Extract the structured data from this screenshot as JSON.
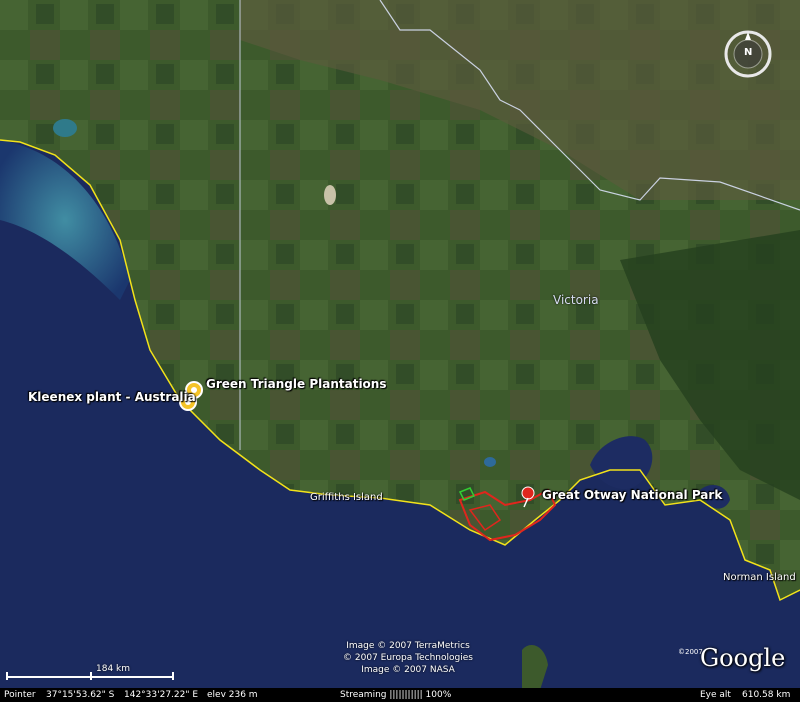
{
  "map": {
    "placemarks": [
      {
        "name": "Kleenex plant - Australia",
        "icon": "placemark-pin-icon"
      },
      {
        "name": "Green Triangle Plantations",
        "icon": "placemark-pin-icon"
      },
      {
        "name": "Great Otway National Park",
        "icon": "red-pushpin-icon"
      }
    ],
    "places": {
      "griffiths": "Griffiths Island",
      "norman": "Norman Island",
      "victoria": "Victoria"
    },
    "copyright": [
      "Image © 2007 TerraMetrics",
      "© 2007 Europa Technologies",
      "Image © 2007 NASA"
    ],
    "logo": {
      "text": "Google",
      "year": "©2007"
    },
    "scale": {
      "label": "184 km"
    },
    "compass": {
      "north": "N"
    }
  },
  "status": {
    "pointer_label": "Pointer",
    "lat": "37°15'53.62\" S",
    "lon": "142°33'27.22\" E",
    "elev": "elev  236 m",
    "streaming": "Streaming ||||||||||| 100%",
    "eye_alt_label": "Eye alt",
    "eye_alt": "610.58 km"
  },
  "colors": {
    "ocean": "#1b2a5e",
    "land": "#3f5a2e",
    "coastline": "#f2e21a",
    "border": "#dfe6ff",
    "park": "#e0261d"
  }
}
